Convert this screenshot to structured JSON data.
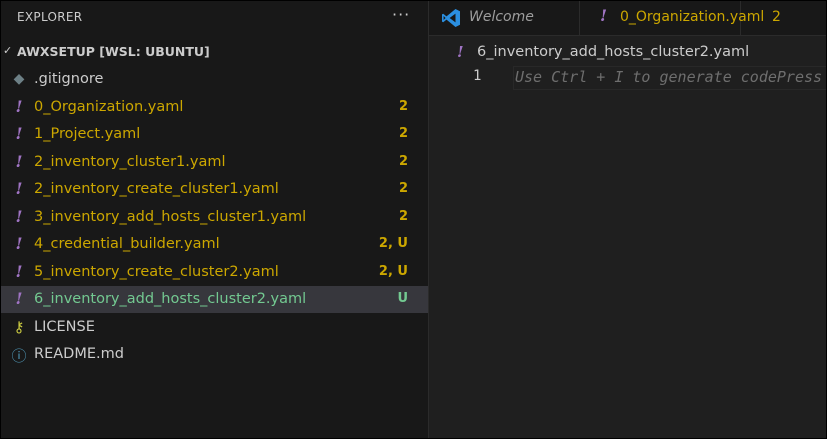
{
  "explorer": {
    "title": "EXPLORER",
    "more_label": "···",
    "root_label": "AWXSETUP [WSL: UBUNTU]",
    "files": [
      {
        "name": ".gitignore",
        "icon": "git-icon",
        "badge": "",
        "status": "normal"
      },
      {
        "name": "0_Organization.yaml",
        "icon": "yaml-icon",
        "badge": "2",
        "status": "modified"
      },
      {
        "name": "1_Project.yaml",
        "icon": "yaml-icon",
        "badge": "2",
        "status": "modified"
      },
      {
        "name": "2_inventory_cluster1.yaml",
        "icon": "yaml-icon",
        "badge": "2",
        "status": "modified"
      },
      {
        "name": "2_inventory_create_cluster1.yaml",
        "icon": "yaml-icon",
        "badge": "2",
        "status": "modified"
      },
      {
        "name": "3_inventory_add_hosts_cluster1.yaml",
        "icon": "yaml-icon",
        "badge": "2",
        "status": "modified"
      },
      {
        "name": "4_credential_builder.yaml",
        "icon": "yaml-icon",
        "badge": "2, U",
        "status": "modified"
      },
      {
        "name": "5_inventory_create_cluster2.yaml",
        "icon": "yaml-icon",
        "badge": "2, U",
        "status": "modified"
      },
      {
        "name": "6_inventory_add_hosts_cluster2.yaml",
        "icon": "yaml-icon",
        "badge": "U",
        "status": "untracked"
      },
      {
        "name": "LICENSE",
        "icon": "license-icon",
        "badge": "",
        "status": "normal"
      },
      {
        "name": "README.md",
        "icon": "info-icon",
        "badge": "",
        "status": "normal"
      }
    ]
  },
  "tabs": [
    {
      "label": "Welcome",
      "icon": "vscode-icon"
    },
    {
      "label": "0_Organization.yaml",
      "icon": "yaml-icon",
      "count": "2"
    }
  ],
  "editor": {
    "breadcrumb": "6_inventory_add_hosts_cluster2.yaml",
    "line_number": "1",
    "hint": "Use Ctrl + I to generate codePress"
  },
  "colors": {
    "modified": "#cca700",
    "untracked": "#73c991",
    "yaml_icon": "#a074c4",
    "selection": "#37373d"
  }
}
